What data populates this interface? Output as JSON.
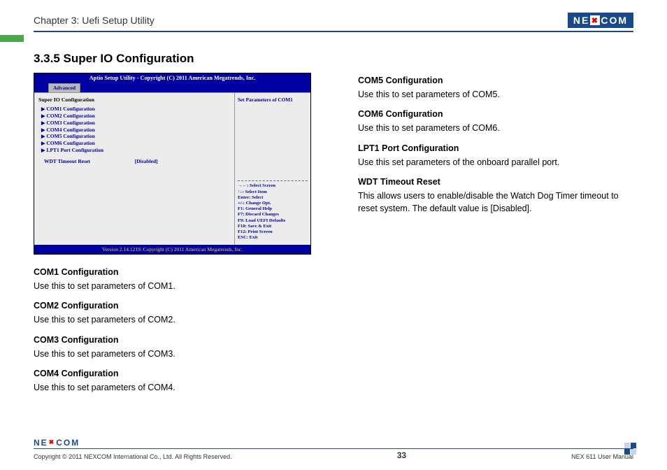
{
  "header": {
    "chapter": "Chapter 3: Uefi Setup Utility",
    "logo": {
      "pre": "NE",
      "x": "✖",
      "post": "COM"
    }
  },
  "section_title": "3.3.5 Super IO Configuration",
  "bios": {
    "topbar": "Aptio Setup Utility - Copyright (C) 2011 American Megatrends, Inc.",
    "tab": "Advanced",
    "main_head": "Super IO Configuration",
    "items": [
      "COM1 Configuration",
      "COM2 Configuration",
      "COM3 Configuration",
      "COM4 Configuration",
      "COM5 Configuration",
      "COM6 Configuration",
      "LPT1 Port Configuration"
    ],
    "wdt_label": "WDT Timeout Reset",
    "wdt_value": "[Disabled]",
    "side_top": "Set Parameters of COM1",
    "help": [
      "→←: Select Screen",
      "↑↓: Select Item",
      "Enter: Select",
      "+/-: Change Opt.",
      "F1: General Help",
      "F7: Discard Changes",
      "F9: Load UEFI Defaults",
      "F10: Save & Exit",
      "F12: Print Screen",
      "ESC: Exit"
    ],
    "bottombar": "Version 2.14.1219. Copyright (C) 2011 American Megatrends, Inc."
  },
  "left_desc": [
    {
      "h": "COM1 Configuration",
      "p": "Use this to set parameters of COM1."
    },
    {
      "h": "COM2 Configuration",
      "p": "Use this to set parameters of COM2."
    },
    {
      "h": "COM3 Configuration",
      "p": "Use this to set parameters of COM3."
    },
    {
      "h": "COM4 Configuration",
      "p": "Use this to set parameters of COM4."
    }
  ],
  "right_desc": [
    {
      "h": "COM5 Configuration",
      "p": "Use this to set parameters of COM5."
    },
    {
      "h": "COM6 Configuration",
      "p": "Use this to set parameters of COM6."
    },
    {
      "h": "LPT1 Port Configuration",
      "p": "Use this set parameters of the onboard parallel port."
    },
    {
      "h": "WDT Timeout Reset",
      "p": "This allows users to enable/disable the Watch Dog Timer timeout to reset system. The default value is [Disabled]."
    }
  ],
  "footer": {
    "logo": {
      "pre": "NE",
      "x": "✖",
      "post": "COM"
    },
    "copyright": "Copyright © 2011 NEXCOM International Co., Ltd. All Rights Reserved.",
    "page": "33",
    "manual": "NEX 611 User Manual"
  }
}
